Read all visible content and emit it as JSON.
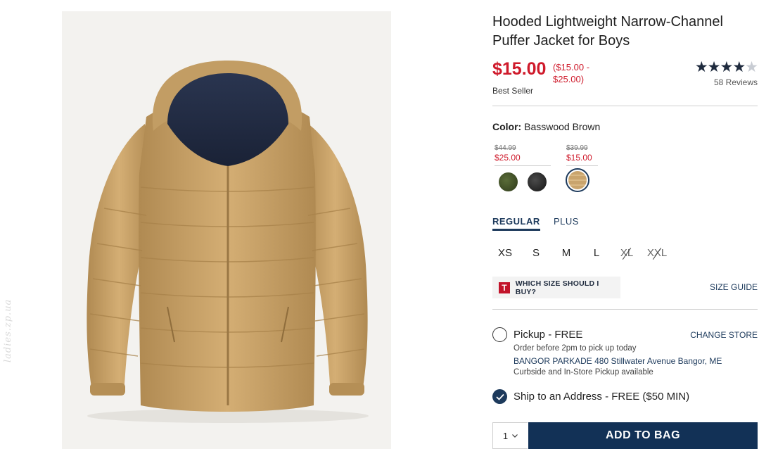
{
  "product": {
    "title": "Hooded Lightweight Narrow-Channel Puffer Jacket for Boys",
    "price": "$15.00",
    "price_range": "($15.00 - $25.00)",
    "badge": "Best Seller",
    "rating": {
      "stars": 4.5,
      "reviews_label": "58 Reviews"
    }
  },
  "color": {
    "label": "Color:",
    "selected": "Basswood Brown",
    "groups": [
      {
        "old_price": "$44.99",
        "new_price": "$25.00",
        "swatches": [
          "green",
          "black"
        ]
      },
      {
        "old_price": "$39.99",
        "new_price": "$15.00",
        "swatches": [
          "tan"
        ]
      }
    ]
  },
  "fit_tabs": [
    {
      "label": "REGULAR",
      "active": true
    },
    {
      "label": "PLUS",
      "active": false
    }
  ],
  "sizes": [
    {
      "label": "XS",
      "available": true
    },
    {
      "label": "S",
      "available": true
    },
    {
      "label": "M",
      "available": true
    },
    {
      "label": "L",
      "available": true
    },
    {
      "label": "XL",
      "available": false
    },
    {
      "label": "XXL",
      "available": false
    }
  ],
  "fit_help": {
    "icon_letter": "T",
    "label": "WHICH SIZE SHOULD I BUY?"
  },
  "size_guide": "SIZE GUIDE",
  "pickup": {
    "label": "Pickup - FREE",
    "change_store": "CHANGE STORE",
    "note": "Order before 2pm to pick up today",
    "store": "BANGOR PARKADE 480 Stillwater Avenue  Bangor, ME",
    "availability": "Curbside and In-Store Pickup available",
    "selected": false
  },
  "shipping": {
    "label": "Ship to an Address - FREE ($50 MIN)",
    "selected": true
  },
  "cart": {
    "quantity": "1",
    "add_label": "ADD TO BAG"
  },
  "watermark": "ladies.zp.ua",
  "colors": {
    "sale_red": "#cf1a2b",
    "navy": "#123156",
    "link_blue": "#1d3a5c"
  }
}
